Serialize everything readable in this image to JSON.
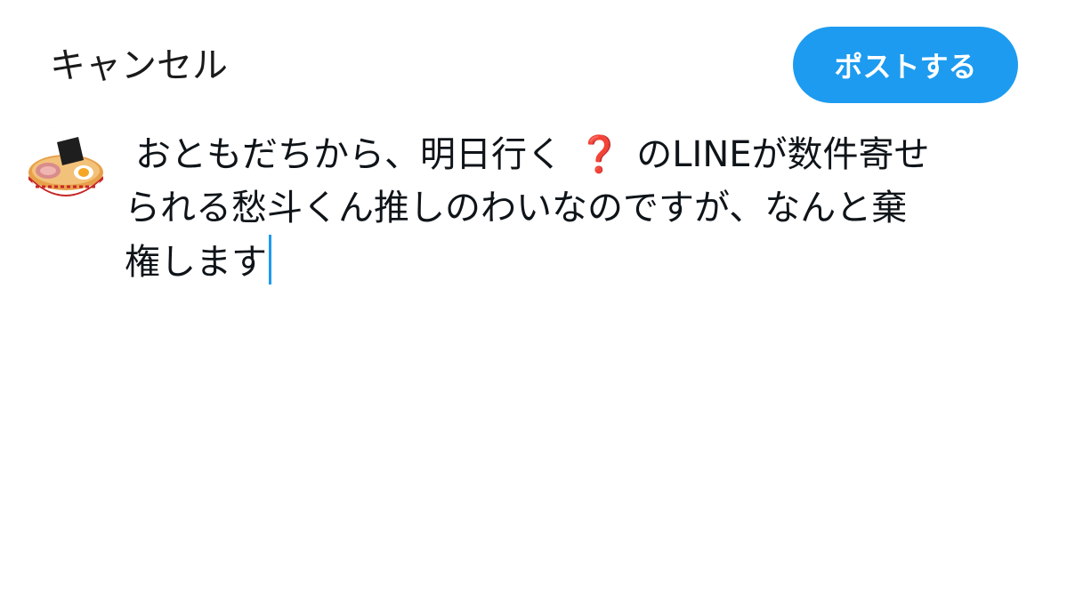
{
  "header": {
    "cancel_label": "キャンセル",
    "post_label": "ポストする"
  },
  "composer": {
    "line1_before": "おともだちから、明日行く",
    "question_mark": "❓",
    "line1_after": "のLINEが数件寄せ",
    "line2": "られる愁斗くん推しのわいなのですが、なんと棄",
    "line3": "権します"
  },
  "colors": {
    "accent": "#1d9bf0",
    "question_mark": "#e0162b",
    "text": "#0f1419"
  },
  "avatar": {
    "icon": "ramen-bowl-icon"
  }
}
